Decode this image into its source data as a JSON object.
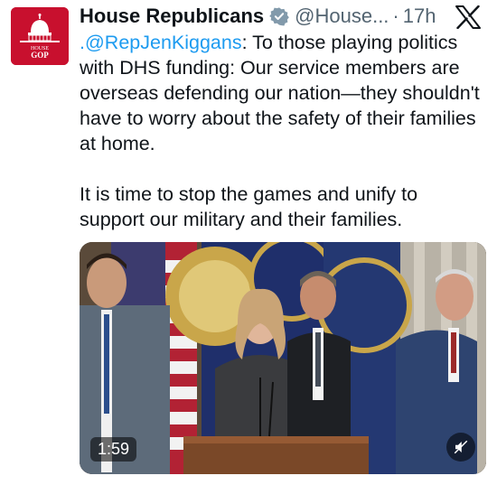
{
  "author": {
    "name": "House Republicans",
    "handle": "@House...",
    "separator": "·",
    "time": "17h",
    "verified": true,
    "verified_icon": "gray-verified-badge-icon",
    "avatar_lines": [
      "HOUSE",
      "GOP"
    ],
    "avatar_color": "#c8102e"
  },
  "post": {
    "mention": ".@RepJenKiggans",
    "paragraph1_rest": ": To those playing politics with DHS funding: Our service members are overseas defending our nation—they shouldn't have to worry about the safety of their families at home.",
    "paragraph2": "It is time to stop the games and unify to support our military and their families."
  },
  "video": {
    "duration": "1:59",
    "mute_icon": "muted-speaker-icon"
  },
  "close_icon": "x-logo-icon",
  "colors": {
    "mention": "#1d9bf0",
    "secondary_text": "#536471",
    "verified_badge": "#829aab"
  }
}
